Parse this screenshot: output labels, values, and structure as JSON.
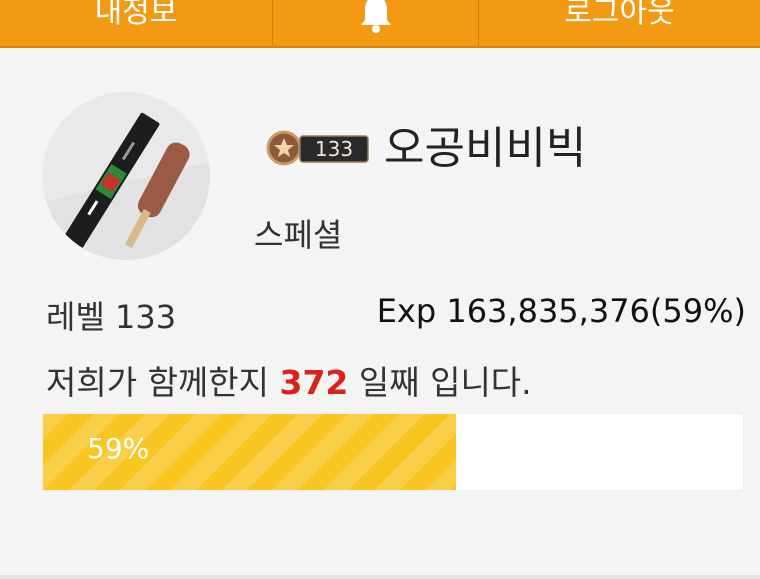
{
  "header": {
    "left_label": "내정보",
    "center_icon": "bell-icon",
    "right_label": "로그아웃"
  },
  "profile": {
    "avatar_icon": "ice-cream-bar-photo",
    "level_badge": "133",
    "nickname": "오공비비빅",
    "grade": "스페셜"
  },
  "stats": {
    "level_text": "레벨 133",
    "exp_text": "Exp 163,835,376(59%)"
  },
  "days": {
    "prefix": "저희가 함께한지 ",
    "count": "372",
    "suffix": " 일째 입니다."
  },
  "progress": {
    "percent": 59,
    "label": "59%"
  },
  "colors": {
    "header_bg": "#f39a14",
    "progress_fill": "#f8c521",
    "days_accent": "#d9231a"
  }
}
